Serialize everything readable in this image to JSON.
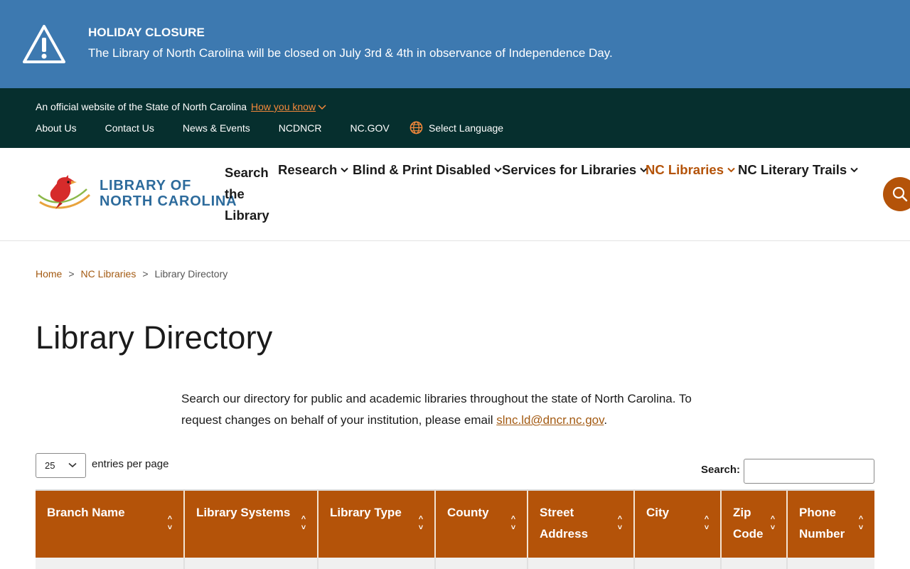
{
  "alert": {
    "title": "HOLIDAY CLOSURE",
    "message": "The Library of North Carolina will be closed on July 3rd & 4th in observance of Independence Day."
  },
  "govbar": {
    "official_text": "An official website of the State of North Carolina",
    "how_you_know": "How you know",
    "links": [
      "About Us",
      "Contact Us",
      "News & Events",
      "NCDNCR",
      "NC.GOV"
    ],
    "language": "Select Language"
  },
  "header": {
    "logo_line1": "LIBRARY OF",
    "logo_line2": "NORTH CAROLINA",
    "search_library": "Search the Library",
    "nav": [
      "Research",
      "Blind & Print Disabled",
      "Services for Libraries",
      "NC Libraries",
      "NC Literary Trails"
    ],
    "active_nav": "NC Libraries",
    "accent_color": "#b45309"
  },
  "breadcrumb": {
    "items": [
      "Home",
      "NC Libraries",
      "Library Directory"
    ],
    "separator": ">"
  },
  "page": {
    "title": "Library Directory",
    "intro_text": "Search our directory for public and academic libraries throughout the state of North Carolina. To request changes on behalf of your institution, please email ",
    "intro_email": "slnc.ld@dncr.nc.gov",
    "intro_end": "."
  },
  "table_controls": {
    "entries_value": "25",
    "entries_label": "entries per page",
    "search_label": "Search:",
    "search_value": ""
  },
  "table": {
    "columns": [
      "Branch Name",
      "Library Systems",
      "Library Type",
      "County",
      "Street Address",
      "City",
      "Zip Code",
      "Phone Number"
    ],
    "sort_icon": "^˅"
  }
}
